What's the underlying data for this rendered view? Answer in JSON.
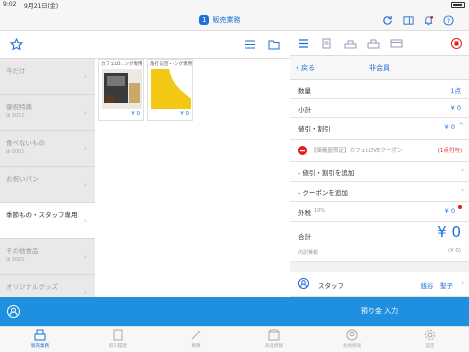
{
  "status": {
    "time": "9:02",
    "date": "9月21日(金)"
  },
  "header": {
    "badge": "1",
    "title": "販売業務"
  },
  "categories": [
    {
      "name": "今だけ",
      "code": ""
    },
    {
      "name": "御祝特典",
      "code": "0010"
    },
    {
      "name": "食べないもの",
      "code": "0001"
    },
    {
      "name": "お祝いパン",
      "code": ""
    },
    {
      "name": "季節もの・スタッフ専用",
      "code": ""
    },
    {
      "name": "その他食品",
      "code": "0001"
    },
    {
      "name": "オリジナルグッズ",
      "code": ""
    }
  ],
  "products": [
    {
      "name": "カフェLO...ング専用",
      "price": "¥ 0"
    },
    {
      "name": "角打る団・-ング専用",
      "price": "¥ 0"
    }
  ],
  "right": {
    "back": "戻る",
    "title": "非会員",
    "qty_label": "数量",
    "qty_value": "1点",
    "subtotal_label": "小計",
    "subtotal_value": "¥ 0",
    "discount_label": "値引・割引",
    "discount_value": "¥ 0",
    "coupon_name": "【御義屋限定】カフェLOVEクーポン",
    "coupon_tag": "(1点付与)",
    "add_discount": "- 値引・割引を追加",
    "add_coupon": "- クーポンを追加",
    "tax_label": "外税",
    "tax_rate": "10%",
    "tax_value": "¥ 0",
    "total_label": "合計",
    "total_value": "¥ 0",
    "breakdown_label": "内訳費税",
    "breakdown_value": "(¥ 0)",
    "staff_label": "スタッフ",
    "staff_name": "銭谷　聖子",
    "payment_button": "預り金 入力"
  },
  "tabs": [
    "販売業務",
    "取引履歴",
    "精算",
    "商品情報",
    "会員情報",
    "設定"
  ]
}
